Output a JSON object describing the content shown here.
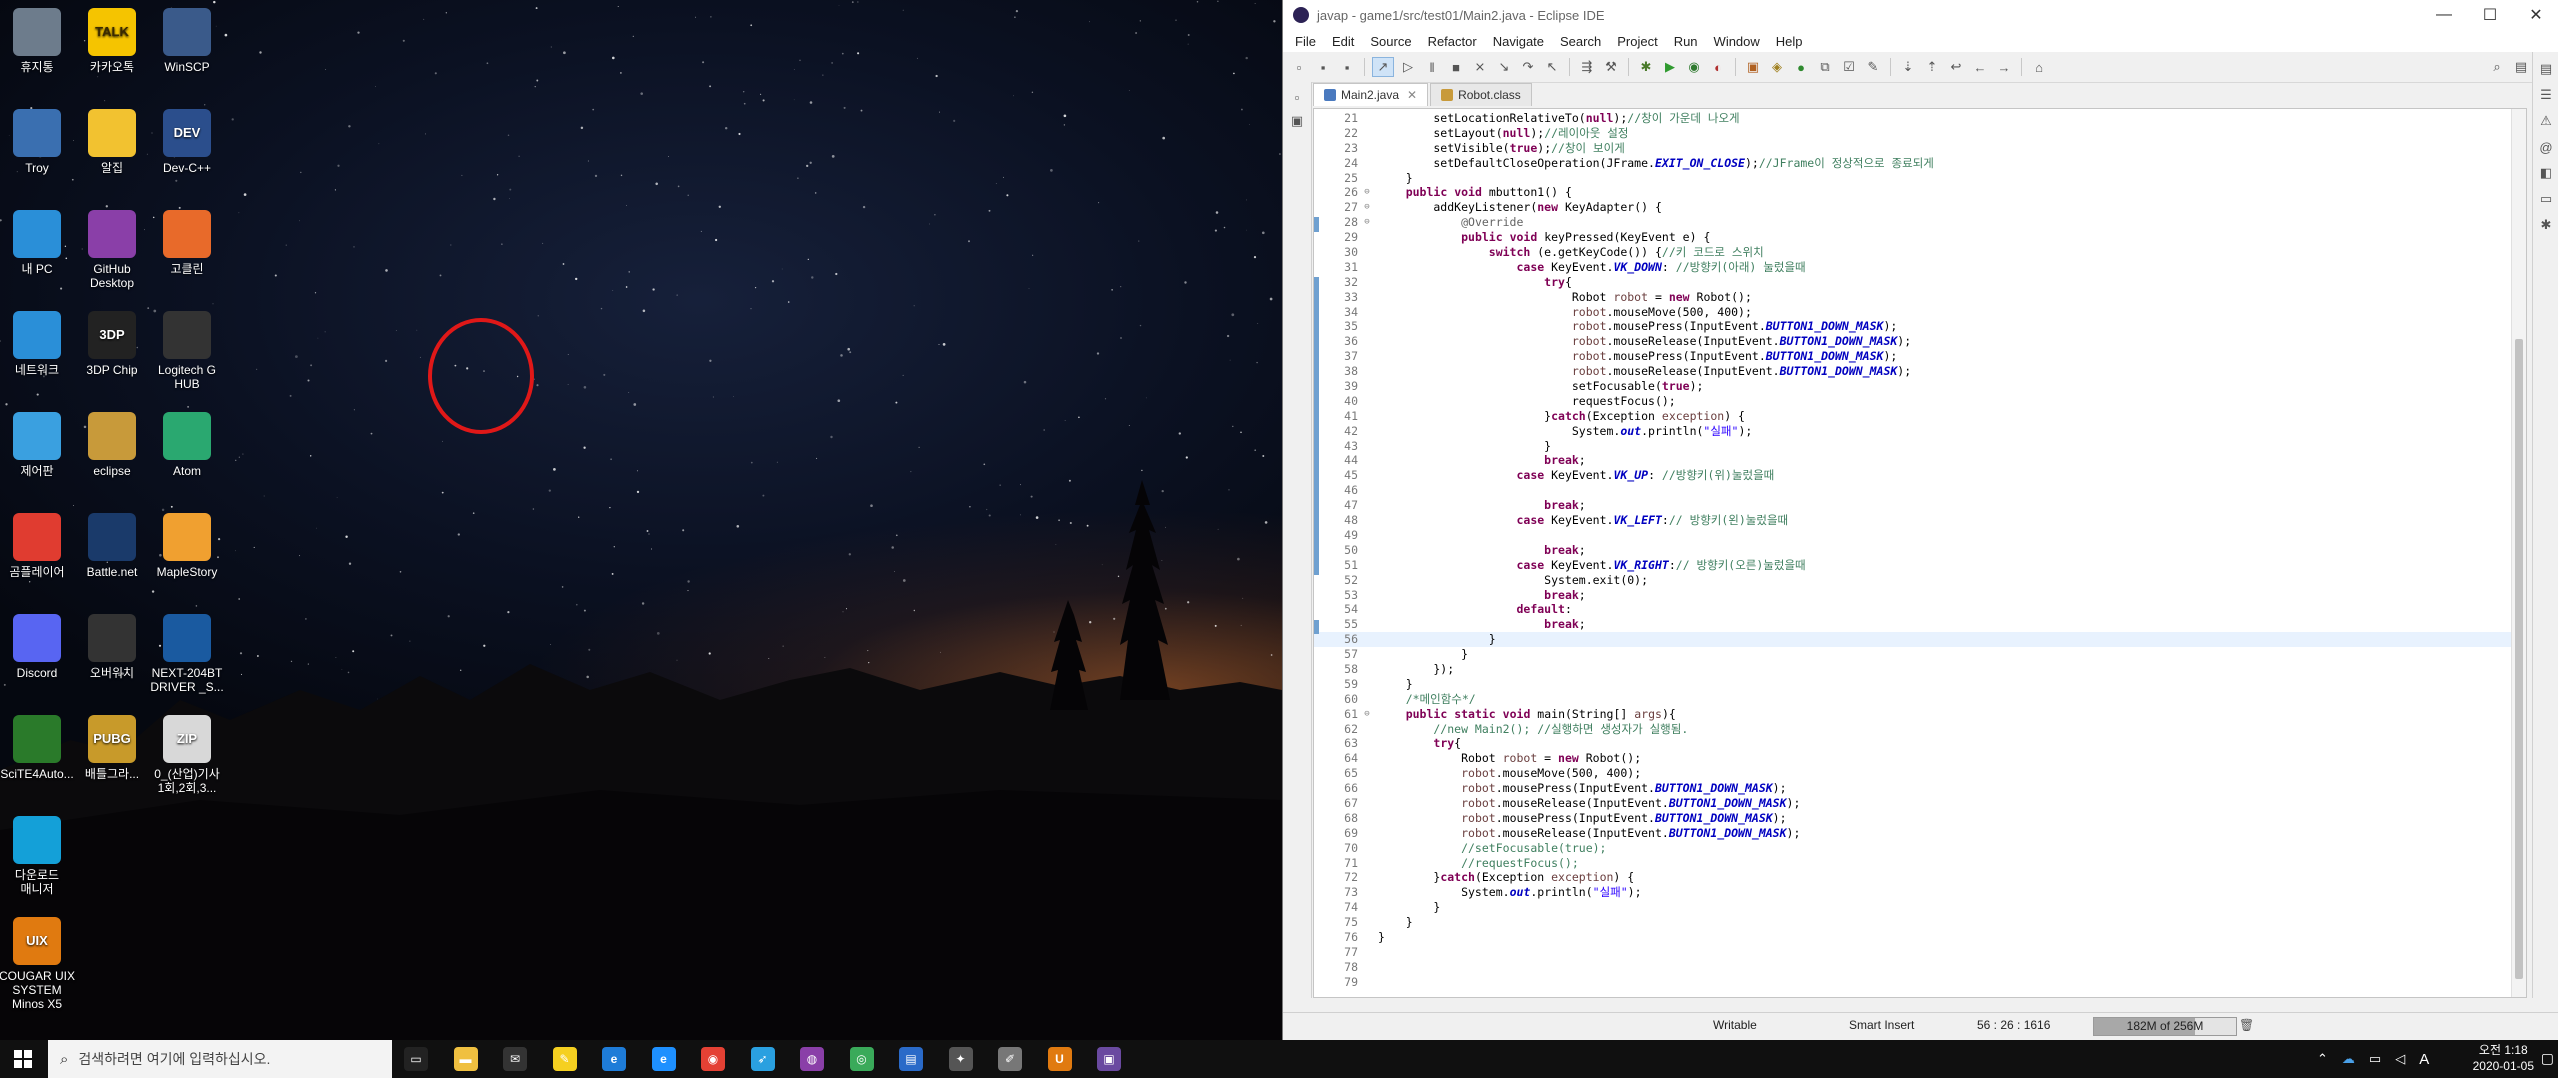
{
  "desktop": {
    "icons": [
      {
        "label": "휴지통"
      },
      {
        "label": "카카오톡"
      },
      {
        "label": "WinSCP"
      },
      {
        "label": "Troy"
      },
      {
        "label": "알집"
      },
      {
        "label": "Dev-C++"
      },
      {
        "label": "내 PC"
      },
      {
        "label": "GitHub\nDesktop"
      },
      {
        "label": "고클린"
      },
      {
        "label": "네트워크"
      },
      {
        "label": "3DP Chip"
      },
      {
        "label": "Logitech G\nHUB"
      },
      {
        "label": "제어판"
      },
      {
        "label": "eclipse"
      },
      {
        "label": "Atom"
      },
      {
        "label": "곰플레이어"
      },
      {
        "label": "Battle.net"
      },
      {
        "label": "MapleStory"
      },
      {
        "label": "Discord"
      },
      {
        "label": "오버워치"
      },
      {
        "label": "NEXT-204BT\nDRIVER _S..."
      },
      {
        "label": "SciTE4Auto..."
      },
      {
        "label": "배틀그라..."
      },
      {
        "label": "0_(산업)기사\n1회,2회,3..."
      },
      {
        "label": "다운로드\n매니저"
      },
      {
        "label": "COUGAR UIX\nSYSTEM\nMinos X5"
      }
    ],
    "icon_badges": {
      "kakao": "TALK",
      "devcpp": "DEV",
      "dp3": "3DP",
      "pubg": "PUBG",
      "zip": "ZIP",
      "uix": "UIX"
    }
  },
  "window": {
    "title": "javap - game1/src/test01/Main2.java - Eclipse IDE",
    "controls": {
      "minimize": "—",
      "maximize": "☐",
      "close": "✕"
    }
  },
  "menu": [
    "File",
    "Edit",
    "Source",
    "Refactor",
    "Navigate",
    "Search",
    "Project",
    "Run",
    "Window",
    "Help"
  ],
  "tabs": [
    {
      "label": "Main2.java",
      "close": "✕"
    },
    {
      "label": "Robot.class"
    }
  ],
  "editor": {
    "lines": [
      {
        "n": "21",
        "code": "        setLocationRelativeTo(null);//창이 가운데 나오게"
      },
      {
        "n": "22",
        "code": "        setLayout(null);//레이아웃 설정"
      },
      {
        "n": "23",
        "code": "        setVisible(true);//창이 보이게"
      },
      {
        "n": "24",
        "code": "        setDefaultCloseOperation(JFrame.EXIT_ON_CLOSE);//JFrame이 정상적으로 종료되게"
      },
      {
        "n": "25",
        "code": "    }"
      },
      {
        "n": "26",
        "code": "    public void mbutton1() {"
      },
      {
        "n": "27",
        "code": "        addKeyListener(new KeyAdapter() {"
      },
      {
        "n": "28",
        "code": "            @Override"
      },
      {
        "n": "29",
        "code": "            public void keyPressed(KeyEvent e) {"
      },
      {
        "n": "30",
        "code": "                switch (e.getKeyCode()) {//키 코드로 스위치"
      },
      {
        "n": "31",
        "code": "                    case KeyEvent.VK_DOWN: //방향키(아래) 눌렀을때"
      },
      {
        "n": "32",
        "code": "                        try{"
      },
      {
        "n": "33",
        "code": "                            Robot robot = new Robot();"
      },
      {
        "n": "34",
        "code": "                            robot.mouseMove(500, 400);"
      },
      {
        "n": "35",
        "code": "                            robot.mousePress(InputEvent.BUTTON1_DOWN_MASK);"
      },
      {
        "n": "36",
        "code": "                            robot.mouseRelease(InputEvent.BUTTON1_DOWN_MASK);"
      },
      {
        "n": "37",
        "code": "                            robot.mousePress(InputEvent.BUTTON1_DOWN_MASK);"
      },
      {
        "n": "38",
        "code": "                            robot.mouseRelease(InputEvent.BUTTON1_DOWN_MASK);"
      },
      {
        "n": "39",
        "code": "                            setFocusable(true);"
      },
      {
        "n": "40",
        "code": "                            requestFocus();"
      },
      {
        "n": "41",
        "code": "                        }catch(Exception exception) {"
      },
      {
        "n": "42",
        "code": "                            System.out.println(\"실패\");"
      },
      {
        "n": "43",
        "code": "                        }"
      },
      {
        "n": "44",
        "code": "                        break;"
      },
      {
        "n": "45",
        "code": "                    case KeyEvent.VK_UP: //방향키(위)눌렀을때"
      },
      {
        "n": "46",
        "code": ""
      },
      {
        "n": "47",
        "code": "                        break;"
      },
      {
        "n": "48",
        "code": "                    case KeyEvent.VK_LEFT:// 방향키(왼)눌렀을때"
      },
      {
        "n": "49",
        "code": ""
      },
      {
        "n": "50",
        "code": "                        break;"
      },
      {
        "n": "51",
        "code": "                    case KeyEvent.VK_RIGHT:// 방향키(오른)눌렀을때"
      },
      {
        "n": "52",
        "code": "                        System.exit(0);"
      },
      {
        "n": "53",
        "code": "                        break;"
      },
      {
        "n": "54",
        "code": "                    default:"
      },
      {
        "n": "55",
        "code": "                        break;"
      },
      {
        "n": "56",
        "code": "                }"
      },
      {
        "n": "57",
        "code": "            }"
      },
      {
        "n": "58",
        "code": "        });"
      },
      {
        "n": "59",
        "code": "    }"
      },
      {
        "n": "60",
        "code": "    /*메인함수*/"
      },
      {
        "n": "61",
        "code": "    public static void main(String[] args){"
      },
      {
        "n": "62",
        "code": "        //new Main2(); //실행하면 생성자가 실행됨."
      },
      {
        "n": "63",
        "code": "        try{"
      },
      {
        "n": "64",
        "code": "            Robot robot = new Robot();"
      },
      {
        "n": "65",
        "code": "            robot.mouseMove(500, 400);"
      },
      {
        "n": "66",
        "code": "            robot.mousePress(InputEvent.BUTTON1_DOWN_MASK);"
      },
      {
        "n": "67",
        "code": "            robot.mouseRelease(InputEvent.BUTTON1_DOWN_MASK);"
      },
      {
        "n": "68",
        "code": "            robot.mousePress(InputEvent.BUTTON1_DOWN_MASK);"
      },
      {
        "n": "69",
        "code": "            robot.mouseRelease(InputEvent.BUTTON1_DOWN_MASK);"
      },
      {
        "n": "70",
        "code": "            //setFocusable(true);"
      },
      {
        "n": "71",
        "code": "            //requestFocus();"
      },
      {
        "n": "72",
        "code": "        }catch(Exception exception) {"
      },
      {
        "n": "73",
        "code": "            System.out.println(\"실패\");"
      },
      {
        "n": "74",
        "code": "        }"
      },
      {
        "n": "75",
        "code": "    }"
      },
      {
        "n": "76",
        "code": "}"
      },
      {
        "n": "77",
        "code": ""
      },
      {
        "n": "78",
        "code": ""
      },
      {
        "n": "79",
        "code": ""
      }
    ],
    "current_line": "56",
    "folded_lines": [
      "26",
      "27",
      "28",
      "61"
    ]
  },
  "status": {
    "writable": "Writable",
    "insert_mode": "Smart Insert",
    "position": "56 : 26 : 1616",
    "heap": "182M of 256M",
    "heap_used_fraction": 0.71
  },
  "taskbar": {
    "search_placeholder": "검색하려면 여기에 입력하십시오.",
    "ime": "A",
    "time": "오전 1:18",
    "date": "2020-01-05",
    "pinned": [
      "task-view",
      "file-explorer",
      "mail",
      "sticky-notes",
      "edge",
      "internet-explorer",
      "chrome",
      "feather",
      "bandizip",
      "game",
      "network-app",
      "photos",
      "pen",
      "uix",
      "player"
    ]
  },
  "colors": {
    "keyword": "#7f0055",
    "comment": "#3f7f5f",
    "string": "#2a00ff",
    "field": "#0000c0",
    "annotation": "#646464",
    "red_circle": "#e01818"
  }
}
